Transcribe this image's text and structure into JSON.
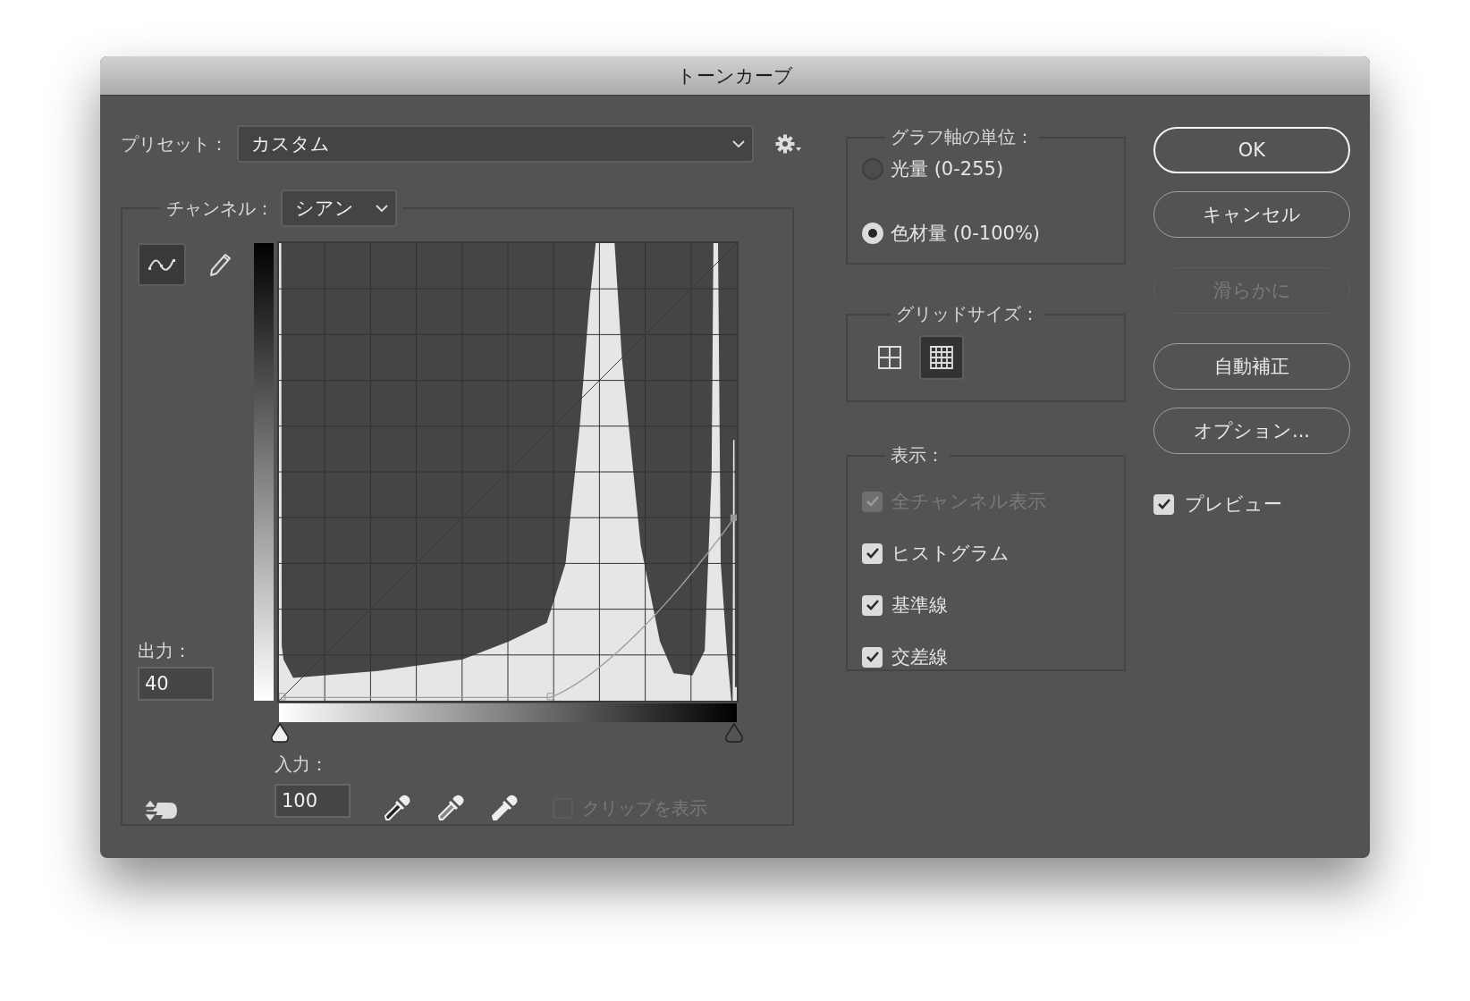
{
  "window": {
    "title": "トーンカーブ"
  },
  "preset": {
    "label": "プリセット：",
    "value": "カスタム"
  },
  "channel": {
    "label": "チャンネル：",
    "value": "シアン"
  },
  "tools": [
    {
      "kind": "curve",
      "selected": true
    },
    {
      "kind": "pencil",
      "selected": false
    }
  ],
  "output": {
    "label": "出力：",
    "value": "40"
  },
  "input": {
    "label": "入力：",
    "value": "100"
  },
  "show_clipping": {
    "label": "クリップを表示",
    "checked": false,
    "disabled": true
  },
  "axis_units": {
    "title": "グラフ軸の単位：",
    "options": [
      {
        "label": "光量 (0-255)",
        "selected": false
      },
      {
        "label": "色材量 (0-100%)",
        "selected": true
      }
    ]
  },
  "grid_size": {
    "title": "グリッドサイズ：",
    "options": [
      {
        "kind": "coarse",
        "selected": false
      },
      {
        "kind": "fine",
        "selected": true
      }
    ]
  },
  "display": {
    "title": "表示：",
    "options": [
      {
        "label": "全チャンネル表示",
        "checked": true,
        "disabled": true
      },
      {
        "label": "ヒストグラム",
        "checked": true,
        "disabled": false
      },
      {
        "label": "基準線",
        "checked": true,
        "disabled": false
      },
      {
        "label": "交差線",
        "checked": true,
        "disabled": false
      }
    ]
  },
  "buttons": [
    {
      "label": "OK",
      "default": true,
      "disabled": false
    },
    {
      "label": "キャンセル",
      "default": false,
      "disabled": false
    },
    {
      "label": "滑らかに",
      "default": false,
      "disabled": true
    },
    {
      "label": "自動補正",
      "default": false,
      "disabled": false
    },
    {
      "label": "オプション...",
      "default": false,
      "disabled": false
    }
  ],
  "preview": {
    "label": "プレビュー",
    "checked": true
  }
}
